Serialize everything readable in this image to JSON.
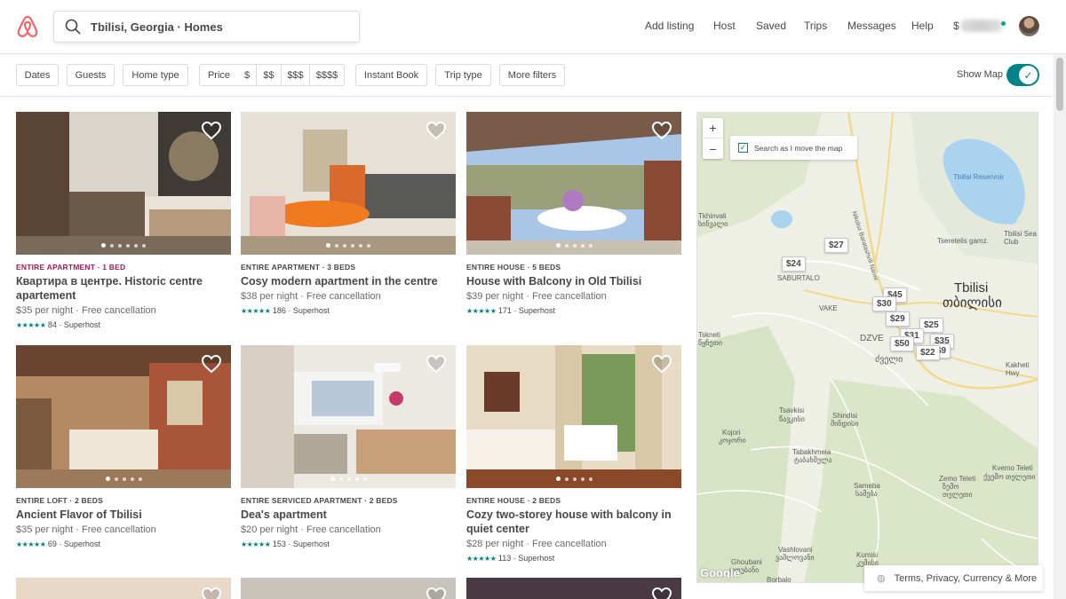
{
  "search": {
    "value": "Tbilisi, Georgia · Homes"
  },
  "nav": {
    "add_listing": "Add listing",
    "host": "Host",
    "saved": "Saved",
    "trips": "Trips",
    "messages": "Messages",
    "help": "Help",
    "currency": "$"
  },
  "filters": {
    "dates": "Dates",
    "guests": "Guests",
    "home_type": "Home type",
    "price": "Price",
    "p1": "$",
    "p2": "$$",
    "p3": "$$$",
    "p4": "$$$$",
    "instant_book": "Instant Book",
    "trip_type": "Trip type",
    "more_filters": "More filters",
    "show_map": "Show Map",
    "show_map_on": true
  },
  "listings": [
    {
      "type": "ENTIRE APARTMENT · 1 BED",
      "title": "Квартира в центре. Historic centre apartement",
      "price": "$35  per night · Free cancellation",
      "stars": "★★★★★",
      "rating": "84 · Superhost"
    },
    {
      "type": "ENTIRE APARTMENT · 3 BEDS",
      "title": "Cosy modern apartment in the centre",
      "price": "$38 per night · Free cancellation",
      "stars": "★★★★★",
      "rating": "186 · Superhost"
    },
    {
      "type": "ENTIRE HOUSE · 5 BEDS",
      "title": "House with Balcony in Old Tbilisi",
      "price": "$39 per night · Free cancellation",
      "stars": "★★★★★",
      "rating": "171 · Superhost"
    },
    {
      "type": "ENTIRE LOFT · 2 BEDS",
      "title": "Ancient Flavor of Tbilisi",
      "price": "$35 per night · Free cancellation",
      "stars": "★★★★★",
      "rating": "69 · Superhost"
    },
    {
      "type": "ENTIRE SERVICED APARTMENT · 2 BEDS",
      "title": "Dea's apartment",
      "price": "$20 per night · Free cancellation",
      "stars": "★★★★★",
      "rating": "153 · Superhost"
    },
    {
      "type": "ENTIRE HOUSE · 2 BEDS",
      "title": "Cozy two-storey house with balcony in quiet center",
      "price": "$28 per night · Free cancellation",
      "stars": "★★★★★",
      "rating": "113 · Superhost"
    }
  ],
  "map": {
    "search_as_move": "Search as I move the map",
    "zoom_in": "+",
    "zoom_out": "−",
    "pins": [
      "$27",
      "$24",
      "$45",
      "$30",
      "$29",
      "$25",
      "$50",
      "$35",
      "$22",
      "$9",
      "$31"
    ],
    "labels": {
      "tbilisi": "Tbilisi",
      "tbilisi_ka": "თბილისი",
      "reservoir": "Tbilisi Reservoir",
      "sea_club": "Tbilisi Sea Club",
      "tskhinvali": "Tkhinvali",
      "tskhinvali_ka": "ხინვალი",
      "saburtalo": "SABURTALO",
      "vake": "VAKE",
      "tskneti": "Tskneti",
      "tskneti_ka": "წყნეთი",
      "dzveli": "DZVE",
      "dzveli_ka": "ძველი",
      "tsavkisi": "Tsavkisi",
      "tsavkisi_ka": "წავკისი",
      "shindisi": "Shindisi",
      "shindisi_ka": "შინდისი",
      "kojori": "Kojori",
      "kojori_ka": "კოჯორი",
      "tabakhmela": "Tabakhmela",
      "tabakhmela_ka": "ტაბახმელა",
      "zemo_teleti": "Zemo Teleti",
      "zemo_teleti_ka": "ზემო თელეთი",
      "kvemo_teleti": "Kvemo Teleti",
      "kvemo_teleti_ka": "ქვემო თელეთი",
      "sameba": "Sameba",
      "sameba_ka": "სამება",
      "vashlovani": "Vashlovani",
      "vashlovani_ka": "ვაშლოვანი",
      "kumisi": "Kumisi",
      "kumisi_ka": "კუმისი",
      "ghoubani": "Ghoubani",
      "ghoubani_ka": "ღოუბანი",
      "borbalo": "Borbalo",
      "tsereteli": "Tseretelis gamz.",
      "kakheti": "Kakheti Hwy",
      "nikoloz": "Nikoloz Baratashvili Name"
    },
    "google": "Google"
  },
  "terms": "Terms, Privacy, Currency & More",
  "colors": {
    "accent": "#008489",
    "brand": "#ff5a5f",
    "type_red": "#a61d55"
  }
}
